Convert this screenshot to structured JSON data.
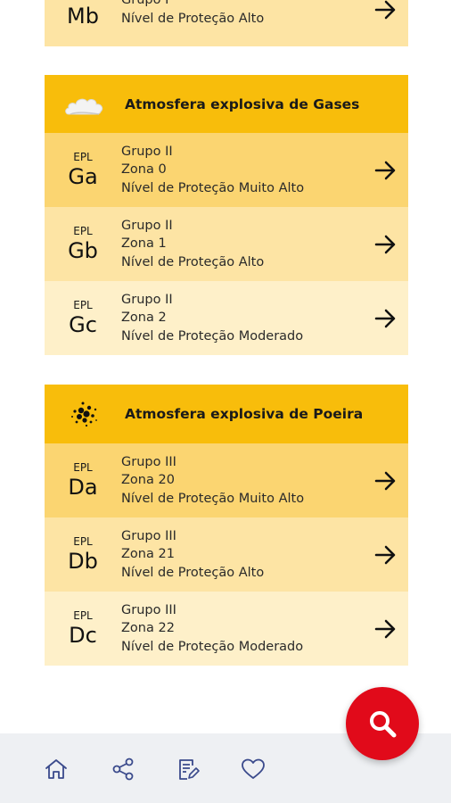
{
  "top_card": {
    "row": {
      "epl_code": "Mb",
      "line1": "Grupo I",
      "line2": "Nível de Proteção Alto"
    }
  },
  "gases": {
    "title": "Atmosfera explosiva de Gases",
    "icon": "cloud-icon",
    "rows": [
      {
        "epl_label": "EPL",
        "epl_code": "Ga",
        "line1": "Grupo II",
        "line2": "Zona 0",
        "line3": "Nível de Proteção Muito Alto"
      },
      {
        "epl_label": "EPL",
        "epl_code": "Gb",
        "line1": "Grupo II",
        "line2": "Zona 1",
        "line3": "Nível de Proteção Alto"
      },
      {
        "epl_label": "EPL",
        "epl_code": "Gc",
        "line1": "Grupo II",
        "line2": "Zona 2",
        "line3": "Nível de Proteção Moderado"
      }
    ]
  },
  "poeira": {
    "title": "Atmosfera explosiva de Poeira",
    "icon": "dust-particles-icon",
    "rows": [
      {
        "epl_label": "EPL",
        "epl_code": "Da",
        "line1": "Grupo III",
        "line2": "Zona 20",
        "line3": "Nível de Proteção Muito Alto"
      },
      {
        "epl_label": "EPL",
        "epl_code": "Db",
        "line1": "Grupo III",
        "line2": "Zona 21",
        "line3": "Nível de Proteção Alto"
      },
      {
        "epl_label": "EPL",
        "epl_code": "Dc",
        "line1": "Grupo III",
        "line2": "Zona 22",
        "line3": "Nível de Proteção Moderado"
      }
    ]
  },
  "nav": {
    "items": [
      "home-icon",
      "share-icon",
      "notes-icon",
      "heart-icon"
    ]
  },
  "fab": {
    "icon": "search-icon"
  },
  "colors": {
    "header": "#f8bd0b",
    "row_strong": "#fbd571",
    "row_medium": "#fde4a4",
    "row_light": "#fef0c9",
    "fab": "#e10a1a",
    "nav_bg": "#eef0f3"
  }
}
